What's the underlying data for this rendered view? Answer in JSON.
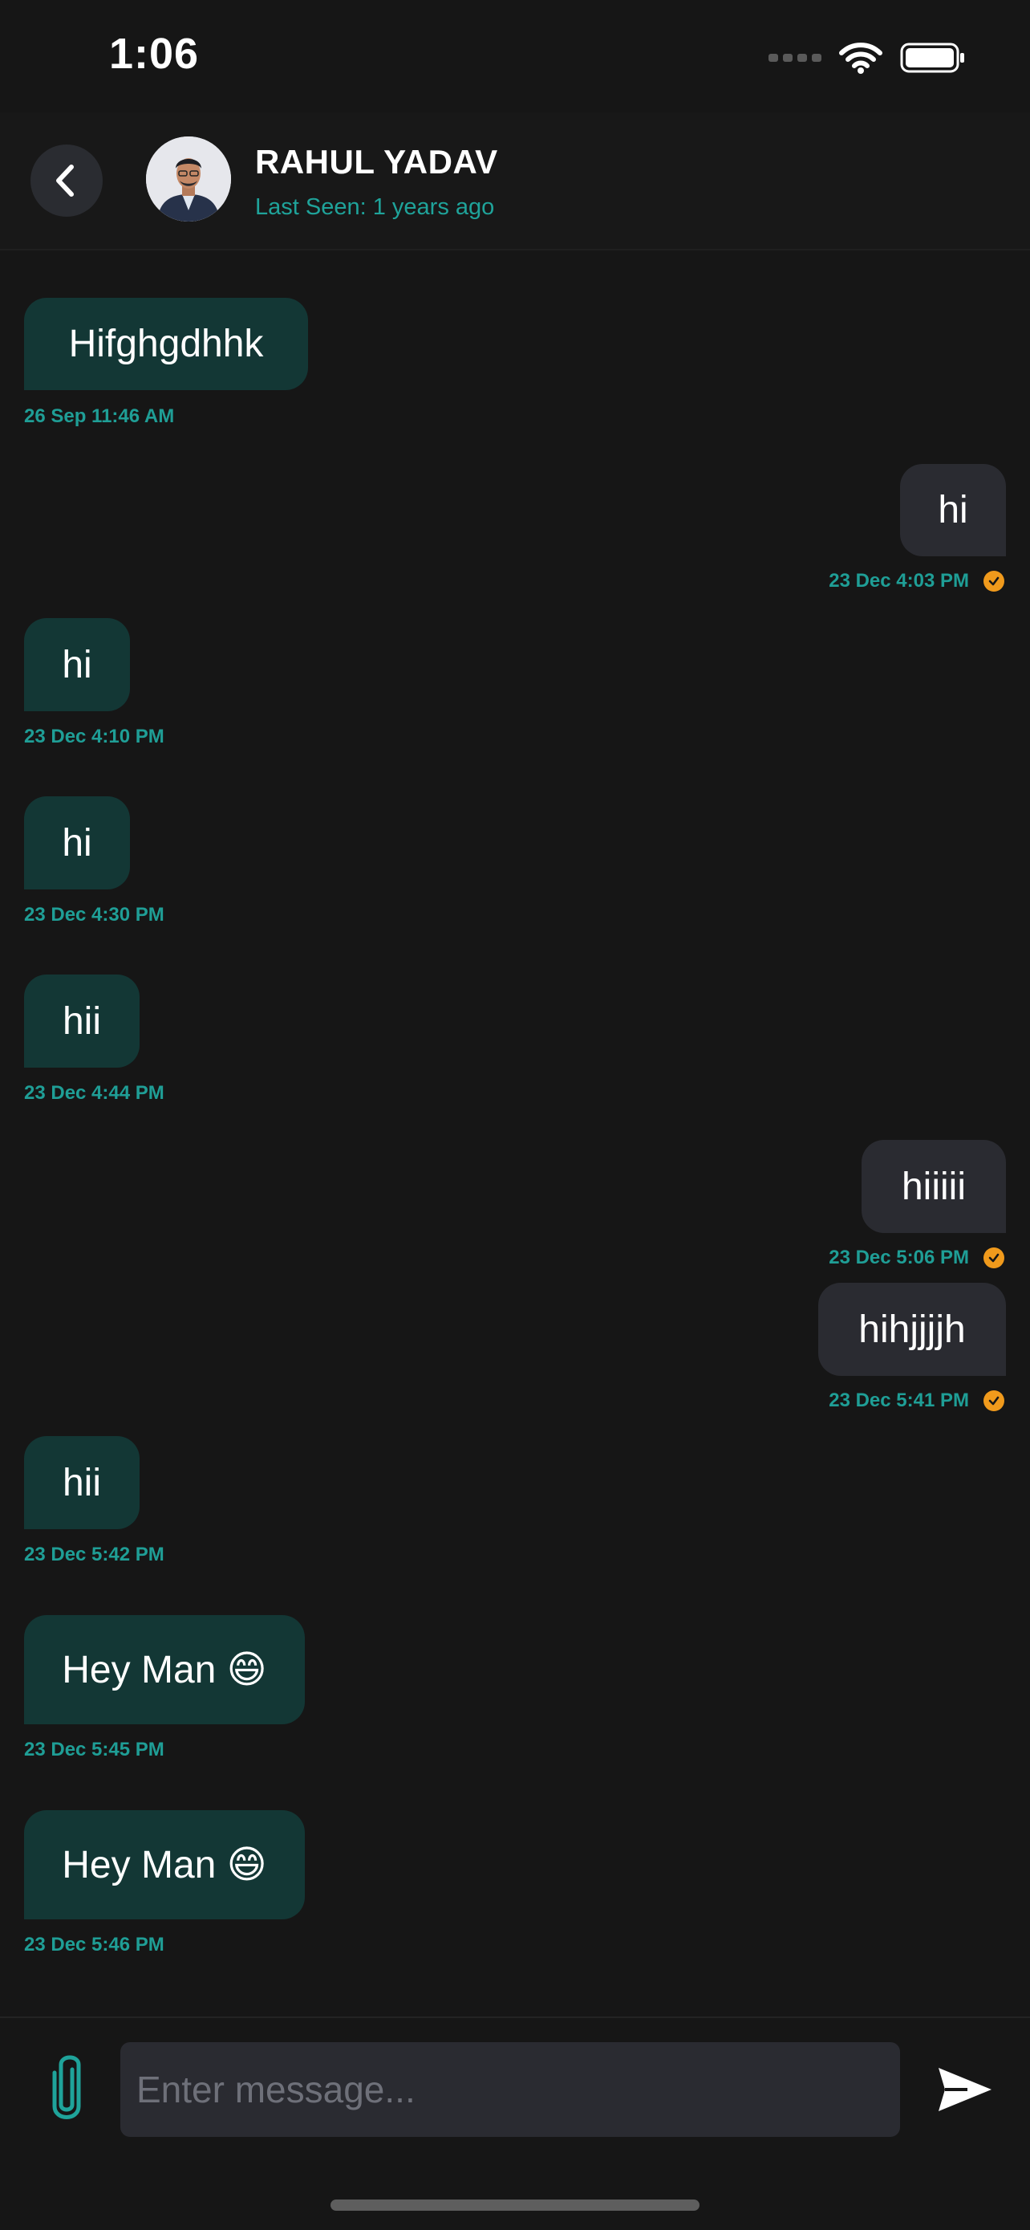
{
  "status_bar": {
    "time": "1:06"
  },
  "header": {
    "contact_name": "RAHUL YADAV",
    "last_seen": "Last Seen: 1 years ago"
  },
  "messages": [
    {
      "direction": "incoming",
      "text": "Hifghgdhhk",
      "time": "26 Sep 11:46 AM"
    },
    {
      "direction": "outgoing",
      "text": "hi",
      "time": "23 Dec 4:03 PM",
      "read": true
    },
    {
      "direction": "incoming",
      "text": "hi",
      "time": "23 Dec 4:10 PM"
    },
    {
      "direction": "incoming",
      "text": "hi",
      "time": "23 Dec 4:30 PM"
    },
    {
      "direction": "incoming",
      "text": "hii",
      "time": "23 Dec 4:44 PM"
    },
    {
      "direction": "outgoing",
      "text": "hiiiii",
      "time": "23 Dec 5:06 PM",
      "read": true
    },
    {
      "direction": "outgoing",
      "text": "hihjjjjh",
      "time": "23 Dec 5:41 PM",
      "read": true
    },
    {
      "direction": "incoming",
      "text": "hii",
      "time": "23 Dec 5:42 PM"
    },
    {
      "direction": "incoming",
      "text": "Hey Man 😄",
      "time": "23 Dec 5:45 PM"
    },
    {
      "direction": "incoming",
      "text": "Hey Man 😄",
      "time": "23 Dec 5:46 PM"
    }
  ],
  "composer": {
    "placeholder": "Enter message...",
    "value": ""
  },
  "icons": {
    "back": "chevron-left-icon",
    "attach": "paperclip-icon",
    "send": "send-icon",
    "read_receipt": "check-circle-icon"
  },
  "colors": {
    "background": "#161616",
    "incoming_bubble": "#133735",
    "outgoing_bubble": "#2a2b31",
    "accent_teal": "#1fa39a",
    "read_tick": "#f09a1c"
  }
}
